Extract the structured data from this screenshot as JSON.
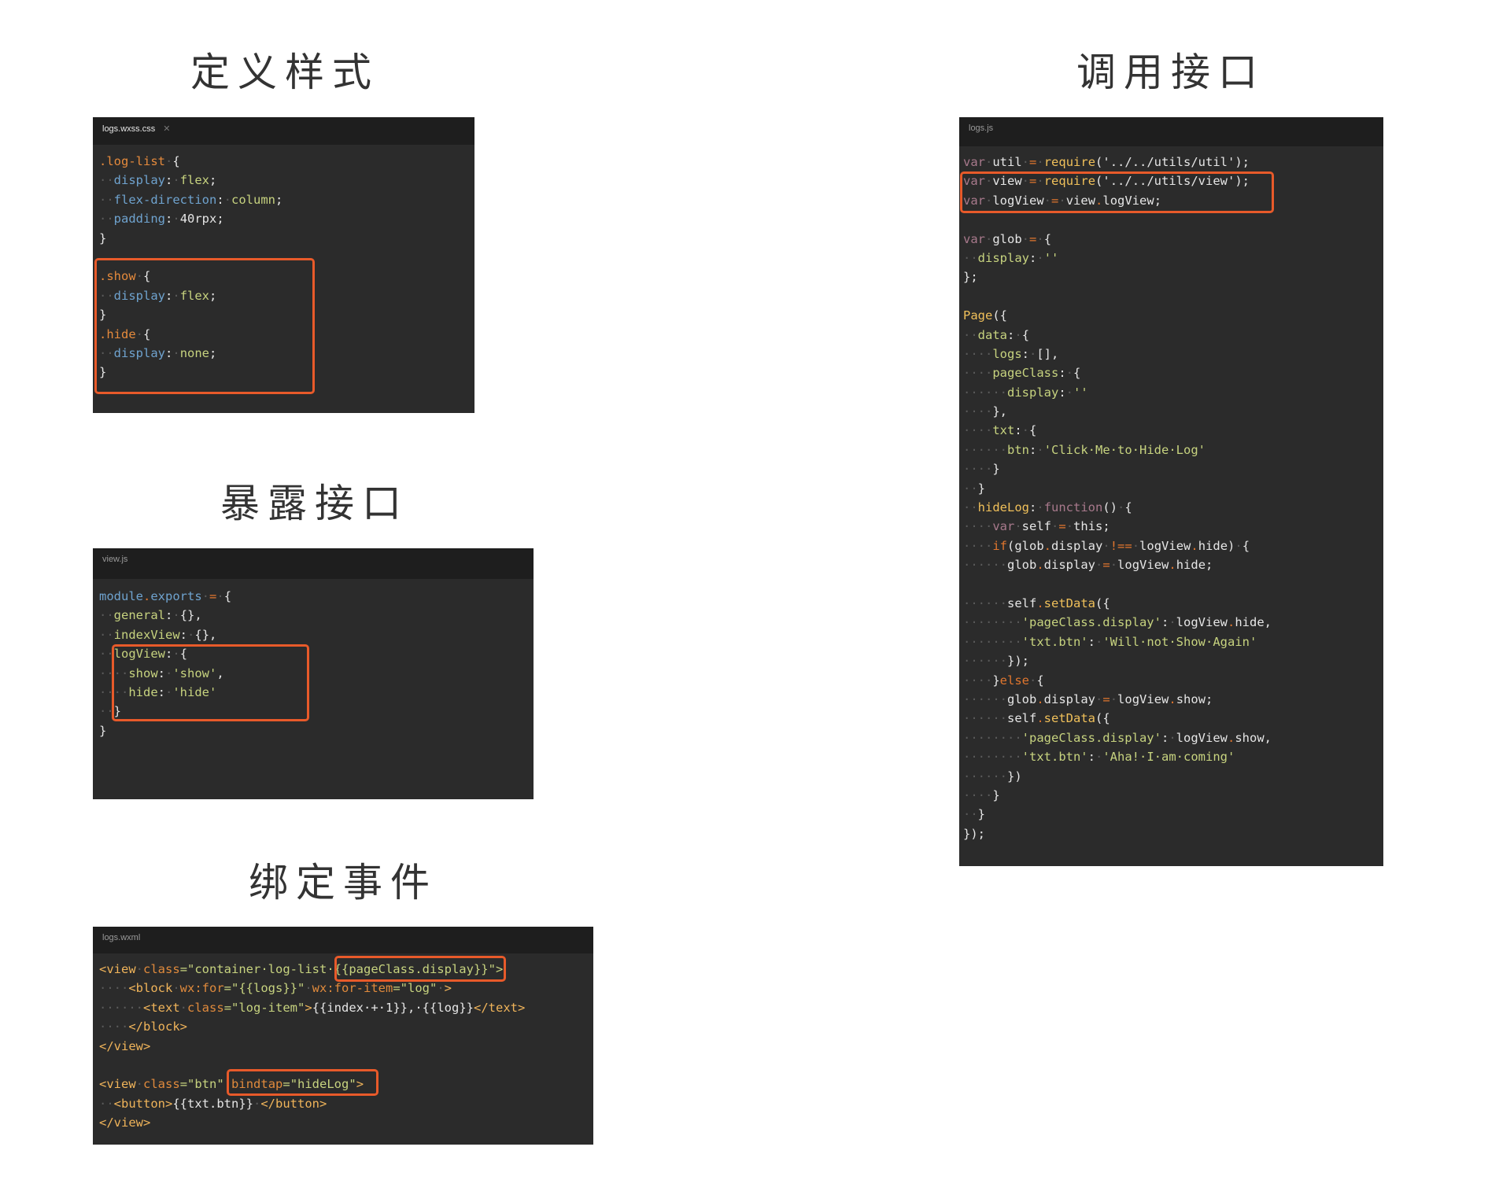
{
  "titles": {
    "define_styles": "定义样式",
    "expose_interface": "暴露接口",
    "bind_event": "绑定事件",
    "call_interface": "调用接口"
  },
  "colors": {
    "highlight": "#e85a2a",
    "editor_bg": "#2b2b2b",
    "tab_bg": "#1e1e1e"
  },
  "panels": {
    "css": {
      "tab": "logs.wxss.css",
      "lines": [
        [
          [
            ".log-list",
            "s"
          ],
          [
            "·",
            "d"
          ],
          [
            "{",
            "w"
          ]
        ],
        [
          [
            "··",
            "d"
          ],
          [
            "display",
            "p"
          ],
          [
            ":",
            "w"
          ],
          [
            "·",
            "d"
          ],
          [
            "flex",
            "v"
          ],
          [
            ";",
            "w"
          ]
        ],
        [
          [
            "··",
            "d"
          ],
          [
            "flex-direction",
            "p"
          ],
          [
            ":",
            "w"
          ],
          [
            "·",
            "d"
          ],
          [
            "column",
            "v"
          ],
          [
            ";",
            "w"
          ]
        ],
        [
          [
            "··",
            "d"
          ],
          [
            "padding",
            "p"
          ],
          [
            ":",
            "w"
          ],
          [
            "·",
            "d"
          ],
          [
            "40rpx",
            "w"
          ],
          [
            ";",
            "w"
          ]
        ],
        [
          [
            "}",
            "w"
          ]
        ],
        [],
        [
          [
            ".show",
            "s"
          ],
          [
            "·",
            "d"
          ],
          [
            "{",
            "w"
          ]
        ],
        [
          [
            "··",
            "d"
          ],
          [
            "display",
            "p"
          ],
          [
            ":",
            "w"
          ],
          [
            "·",
            "d"
          ],
          [
            "flex",
            "v"
          ],
          [
            ";",
            "w"
          ]
        ],
        [
          [
            "}",
            "w"
          ]
        ],
        [
          [
            ".hide",
            "s"
          ],
          [
            "·",
            "d"
          ],
          [
            "{",
            "w"
          ]
        ],
        [
          [
            "··",
            "d"
          ],
          [
            "display",
            "p"
          ],
          [
            ":",
            "w"
          ],
          [
            "·",
            "d"
          ],
          [
            "none",
            "v"
          ],
          [
            ";",
            "w"
          ]
        ],
        [
          [
            "}",
            "w"
          ]
        ]
      ]
    },
    "view": {
      "tab": "view.js",
      "lines": [
        [
          [
            "module",
            "m"
          ],
          [
            ".",
            "o"
          ],
          [
            "exports",
            "m"
          ],
          [
            "·",
            "d"
          ],
          [
            "=",
            "o"
          ],
          [
            "·",
            "d"
          ],
          [
            "{",
            "w"
          ]
        ],
        [
          [
            "··",
            "d"
          ],
          [
            "general",
            "y"
          ],
          [
            ":",
            "w"
          ],
          [
            "·",
            "d"
          ],
          [
            "{},",
            "w"
          ]
        ],
        [
          [
            "··",
            "d"
          ],
          [
            "indexView",
            "y"
          ],
          [
            ":",
            "w"
          ],
          [
            "·",
            "d"
          ],
          [
            "{},",
            "w"
          ]
        ],
        [
          [
            "··",
            "d"
          ],
          [
            "logView",
            "y"
          ],
          [
            ":",
            "w"
          ],
          [
            "·",
            "d"
          ],
          [
            "{",
            "w"
          ]
        ],
        [
          [
            "····",
            "d"
          ],
          [
            "show",
            "y"
          ],
          [
            ":",
            "w"
          ],
          [
            "·",
            "d"
          ],
          [
            "'show'",
            "str"
          ],
          [
            ",",
            "w"
          ]
        ],
        [
          [
            "····",
            "d"
          ],
          [
            "hide",
            "y"
          ],
          [
            ":",
            "w"
          ],
          [
            "·",
            "d"
          ],
          [
            "'hide'",
            "str"
          ]
        ],
        [
          [
            "··",
            "d"
          ],
          [
            "}",
            "w"
          ]
        ],
        [
          [
            "}",
            "w"
          ]
        ]
      ]
    },
    "wxml": {
      "tab": "logs.wxml",
      "lines": [
        [
          [
            "<view",
            "t"
          ],
          [
            "·",
            "d"
          ],
          [
            "class",
            "a"
          ],
          [
            "=\"container·log-list·{{pageClass.display}}\">",
            "str"
          ]
        ],
        [
          [
            "····",
            "d"
          ],
          [
            "<block",
            "t"
          ],
          [
            "·",
            "d"
          ],
          [
            "wx:for",
            "a"
          ],
          [
            "=\"{{logs}}\"",
            "str"
          ],
          [
            "·",
            "d"
          ],
          [
            "wx:for-item",
            "a"
          ],
          [
            "=\"log\"",
            "str"
          ],
          [
            "·",
            "d"
          ],
          [
            ">",
            "t"
          ]
        ],
        [
          [
            "······",
            "d"
          ],
          [
            "<text",
            "t"
          ],
          [
            "·",
            "d"
          ],
          [
            "class",
            "a"
          ],
          [
            "=\"log-item\"",
            "str"
          ],
          [
            ">",
            "t"
          ],
          [
            "{{index·+·1}},·{{log}}",
            "w"
          ],
          [
            "</text>",
            "t"
          ]
        ],
        [
          [
            "····",
            "d"
          ],
          [
            "</block>",
            "t"
          ]
        ],
        [
          [
            "</view>",
            "t"
          ]
        ],
        [],
        [
          [
            "<view",
            "t"
          ],
          [
            "·",
            "d"
          ],
          [
            "class",
            "a"
          ],
          [
            "=\"btn\"",
            "str"
          ],
          [
            "·",
            "d"
          ],
          [
            "bindtap",
            "a"
          ],
          [
            "=\"hideLog\"",
            "str"
          ],
          [
            ">",
            "t"
          ]
        ],
        [
          [
            "··",
            "d"
          ],
          [
            "<button>",
            "t"
          ],
          [
            "{{txt.btn}}",
            "w"
          ],
          [
            "·",
            "d"
          ],
          [
            "</button>",
            "t"
          ]
        ],
        [
          [
            "</view>",
            "t"
          ]
        ]
      ]
    },
    "logs": {
      "tab": "logs.js",
      "lines": [
        [
          [
            "var",
            "k"
          ],
          [
            "·",
            "d"
          ],
          [
            "util",
            "w"
          ],
          [
            "·",
            "d"
          ],
          [
            "=",
            "o"
          ],
          [
            "·",
            "d"
          ],
          [
            "require",
            "f"
          ],
          [
            "('../../utils/util');",
            "w"
          ]
        ],
        [
          [
            "var",
            "k"
          ],
          [
            "·",
            "d"
          ],
          [
            "view",
            "w"
          ],
          [
            "·",
            "d"
          ],
          [
            "=",
            "o"
          ],
          [
            "·",
            "d"
          ],
          [
            "require",
            "f"
          ],
          [
            "('../../utils/view');",
            "w"
          ]
        ],
        [
          [
            "var",
            "k"
          ],
          [
            "·",
            "d"
          ],
          [
            "logView",
            "w"
          ],
          [
            "·",
            "d"
          ],
          [
            "=",
            "o"
          ],
          [
            "·",
            "d"
          ],
          [
            "view",
            "w"
          ],
          [
            ".",
            "o"
          ],
          [
            "logView;",
            "w"
          ]
        ],
        [],
        [
          [
            "var",
            "k"
          ],
          [
            "·",
            "d"
          ],
          [
            "glob",
            "w"
          ],
          [
            "·",
            "d"
          ],
          [
            "=",
            "o"
          ],
          [
            "·",
            "d"
          ],
          [
            "{",
            "w"
          ]
        ],
        [
          [
            "··",
            "d"
          ],
          [
            "display",
            "y"
          ],
          [
            ":",
            "w"
          ],
          [
            "·",
            "d"
          ],
          [
            "''",
            "str"
          ]
        ],
        [
          [
            "};",
            "w"
          ]
        ],
        [],
        [
          [
            "Page",
            "f"
          ],
          [
            "({",
            "w"
          ]
        ],
        [
          [
            "··",
            "d"
          ],
          [
            "data",
            "y"
          ],
          [
            ":",
            "w"
          ],
          [
            "·",
            "d"
          ],
          [
            "{",
            "w"
          ]
        ],
        [
          [
            "····",
            "d"
          ],
          [
            "logs",
            "y"
          ],
          [
            ":",
            "w"
          ],
          [
            "·",
            "d"
          ],
          [
            "[],",
            "w"
          ]
        ],
        [
          [
            "····",
            "d"
          ],
          [
            "pageClass",
            "y"
          ],
          [
            ":",
            "w"
          ],
          [
            "·",
            "d"
          ],
          [
            "{",
            "w"
          ]
        ],
        [
          [
            "······",
            "d"
          ],
          [
            "display",
            "y"
          ],
          [
            ":",
            "w"
          ],
          [
            "·",
            "d"
          ],
          [
            "''",
            "str"
          ]
        ],
        [
          [
            "····",
            "d"
          ],
          [
            "},",
            "w"
          ]
        ],
        [
          [
            "····",
            "d"
          ],
          [
            "txt",
            "y"
          ],
          [
            ":",
            "w"
          ],
          [
            "·",
            "d"
          ],
          [
            "{",
            "w"
          ]
        ],
        [
          [
            "······",
            "d"
          ],
          [
            "btn",
            "y"
          ],
          [
            ":",
            "w"
          ],
          [
            "·",
            "d"
          ],
          [
            "'Click·Me·to·Hide·Log'",
            "str"
          ]
        ],
        [
          [
            "····",
            "d"
          ],
          [
            "}",
            "w"
          ]
        ],
        [
          [
            "··",
            "d"
          ],
          [
            "}",
            "w"
          ]
        ],
        [
          [
            "··",
            "d"
          ],
          [
            "hideLog",
            "f"
          ],
          [
            ":",
            "w"
          ],
          [
            "·",
            "d"
          ],
          [
            "function",
            "k"
          ],
          [
            "()",
            "w"
          ],
          [
            "·",
            "d"
          ],
          [
            "{",
            "w"
          ]
        ],
        [
          [
            "····",
            "d"
          ],
          [
            "var",
            "k"
          ],
          [
            "·",
            "d"
          ],
          [
            "self",
            "w"
          ],
          [
            "·",
            "d"
          ],
          [
            "=",
            "o"
          ],
          [
            "·",
            "d"
          ],
          [
            "this;",
            "w"
          ]
        ],
        [
          [
            "····",
            "d"
          ],
          [
            "if",
            "o"
          ],
          [
            "(glob",
            "w"
          ],
          [
            ".",
            "o"
          ],
          [
            "display",
            "w"
          ],
          [
            "·",
            "d"
          ],
          [
            "!==",
            "o"
          ],
          [
            "·",
            "d"
          ],
          [
            "logView",
            "w"
          ],
          [
            ".",
            "o"
          ],
          [
            "hide)",
            "w"
          ],
          [
            "·",
            "d"
          ],
          [
            "{",
            "w"
          ]
        ],
        [
          [
            "······",
            "d"
          ],
          [
            "glob",
            "w"
          ],
          [
            ".",
            "o"
          ],
          [
            "display",
            "w"
          ],
          [
            "·",
            "d"
          ],
          [
            "=",
            "o"
          ],
          [
            "·",
            "d"
          ],
          [
            "logView",
            "w"
          ],
          [
            ".",
            "o"
          ],
          [
            "hide;",
            "w"
          ]
        ],
        [],
        [
          [
            "······",
            "d"
          ],
          [
            "self",
            "w"
          ],
          [
            ".",
            "o"
          ],
          [
            "setData",
            "f"
          ],
          [
            "({",
            "w"
          ]
        ],
        [
          [
            "········",
            "d"
          ],
          [
            "'pageClass.display'",
            "str"
          ],
          [
            ":",
            "w"
          ],
          [
            "·",
            "d"
          ],
          [
            "logView",
            "w"
          ],
          [
            ".",
            "o"
          ],
          [
            "hide,",
            "w"
          ]
        ],
        [
          [
            "········",
            "d"
          ],
          [
            "'txt.btn'",
            "str"
          ],
          [
            ":",
            "w"
          ],
          [
            "·",
            "d"
          ],
          [
            "'Will·not·Show·Again'",
            "str"
          ]
        ],
        [
          [
            "······",
            "d"
          ],
          [
            "});",
            "w"
          ]
        ],
        [
          [
            "····",
            "d"
          ],
          [
            "}",
            "w"
          ],
          [
            "else",
            "o"
          ],
          [
            "·",
            "d"
          ],
          [
            "{",
            "w"
          ]
        ],
        [
          [
            "······",
            "d"
          ],
          [
            "glob",
            "w"
          ],
          [
            ".",
            "o"
          ],
          [
            "display",
            "w"
          ],
          [
            "·",
            "d"
          ],
          [
            "=",
            "o"
          ],
          [
            "·",
            "d"
          ],
          [
            "logView",
            "w"
          ],
          [
            ".",
            "o"
          ],
          [
            "show;",
            "w"
          ]
        ],
        [
          [
            "······",
            "d"
          ],
          [
            "self",
            "w"
          ],
          [
            ".",
            "o"
          ],
          [
            "setData",
            "f"
          ],
          [
            "({",
            "w"
          ]
        ],
        [
          [
            "········",
            "d"
          ],
          [
            "'pageClass.display'",
            "str"
          ],
          [
            ":",
            "w"
          ],
          [
            "·",
            "d"
          ],
          [
            "logView",
            "w"
          ],
          [
            ".",
            "o"
          ],
          [
            "show,",
            "w"
          ]
        ],
        [
          [
            "········",
            "d"
          ],
          [
            "'txt.btn'",
            "str"
          ],
          [
            ":",
            "w"
          ],
          [
            "·",
            "d"
          ],
          [
            "'Aha!·I·am·coming'",
            "str"
          ]
        ],
        [
          [
            "······",
            "d"
          ],
          [
            "})",
            "w"
          ]
        ],
        [
          [
            "····",
            "d"
          ],
          [
            "}",
            "w"
          ]
        ],
        [
          [
            "··",
            "d"
          ],
          [
            "}",
            "w"
          ]
        ],
        [
          [
            "});",
            "w"
          ]
        ]
      ]
    }
  }
}
